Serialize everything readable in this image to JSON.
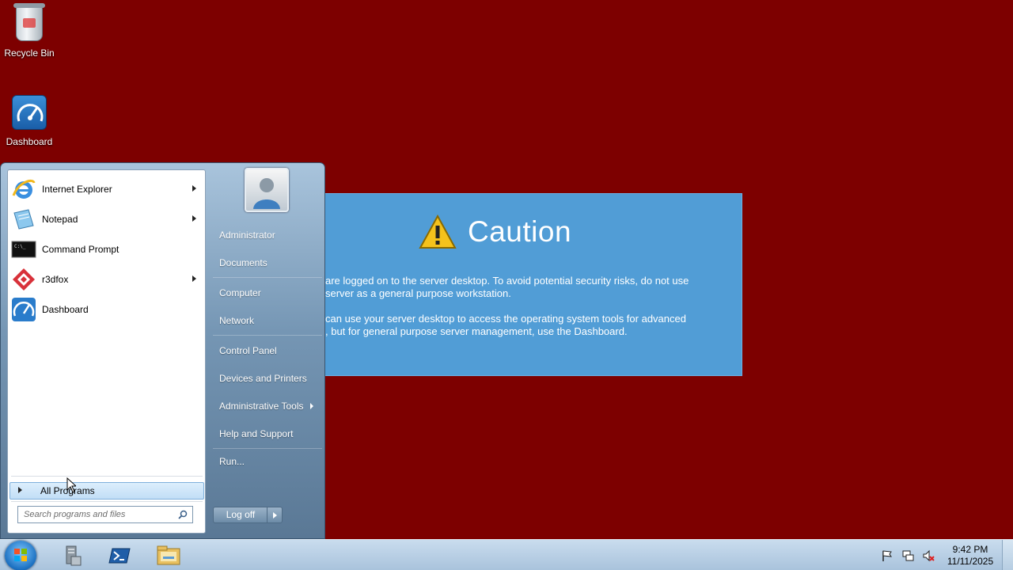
{
  "desktop": {
    "icons": [
      {
        "label": "Recycle Bin",
        "icon": "recycle-bin-icon"
      },
      {
        "label": "Dashboard",
        "icon": "dashboard-icon"
      }
    ],
    "background_color": "#7d0000"
  },
  "caution": {
    "title": "Caution",
    "paragraph1_line1": "are logged on to the server desktop. To avoid potential security risks, do not use",
    "paragraph1_line2": "server as a general purpose workstation.",
    "paragraph2_line1": "can use your server desktop to access the operating system tools for advanced",
    "paragraph2_line2": ", but for general purpose server management, use the Dashboard.",
    "background_color": "#519dd6"
  },
  "start_menu": {
    "pinned": [
      {
        "label": "Internet Explorer",
        "has_arrow": true,
        "icon": "internet-explorer-icon"
      },
      {
        "label": "Notepad",
        "has_arrow": true,
        "icon": "notepad-icon"
      },
      {
        "label": "Command Prompt",
        "has_arrow": false,
        "icon": "command-prompt-icon"
      },
      {
        "label": "r3dfox",
        "has_arrow": true,
        "icon": "r3dfox-icon"
      },
      {
        "label": "Dashboard",
        "has_arrow": false,
        "icon": "dashboard-icon"
      }
    ],
    "all_programs": "All Programs",
    "search_placeholder": "Search programs and files",
    "right_links": [
      {
        "label": "Administrator"
      },
      {
        "label": "Documents"
      },
      {
        "label": "Computer"
      },
      {
        "label": "Network"
      },
      {
        "label": "Control Panel"
      },
      {
        "label": "Devices and Printers"
      },
      {
        "label": "Administrative Tools",
        "has_arrow": true
      },
      {
        "label": "Help and Support"
      },
      {
        "label": "Run..."
      }
    ],
    "logoff": "Log off"
  },
  "taskbar": {
    "pinned": [
      "server-manager-icon",
      "powershell-icon",
      "file-explorer-icon"
    ],
    "tray_icons": [
      "action-center-flag-icon",
      "network-icon",
      "volume-muted-icon"
    ],
    "clock_time": "9:42 PM",
    "clock_date": "11/11/2025"
  }
}
